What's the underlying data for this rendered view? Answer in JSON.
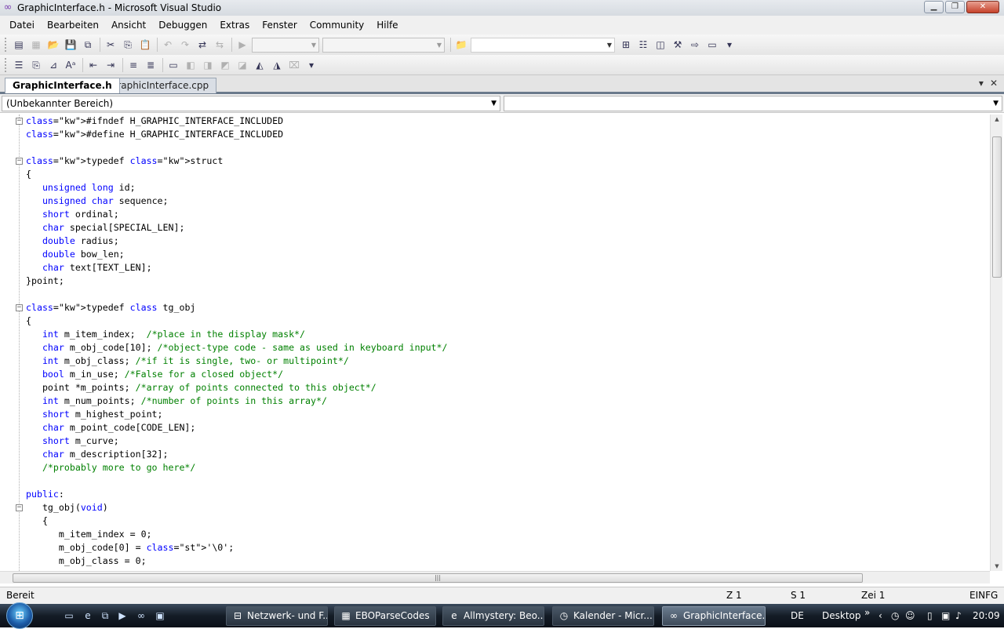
{
  "window": {
    "title": "GraphicInterface.h - Microsoft Visual Studio"
  },
  "menubar": {
    "items": [
      "Datei",
      "Bearbeiten",
      "Ansicht",
      "Debuggen",
      "Extras",
      "Fenster",
      "Community",
      "Hilfe"
    ]
  },
  "tabs": {
    "active": "GraphicInterface.h",
    "inactive": "GraphicInterface.cpp"
  },
  "navbar": {
    "scope": "(Unbekannter Bereich)",
    "member": ""
  },
  "code": {
    "lines": [
      [
        "#ifndef H_GRAPHIC_INTERFACE_INCLUDED"
      ],
      [
        "#define H_GRAPHIC_INTERFACE_INCLUDED"
      ],
      [
        ""
      ],
      [
        "typedef struct"
      ],
      [
        "{"
      ],
      [
        "   unsigned long id;"
      ],
      [
        "   unsigned char sequence;"
      ],
      [
        "   short ordinal;"
      ],
      [
        "   char special[SPECIAL_LEN];"
      ],
      [
        "   double radius;"
      ],
      [
        "   double bow_len;"
      ],
      [
        "   char text[TEXT_LEN];"
      ],
      [
        "}point;"
      ],
      [
        ""
      ],
      [
        "typedef class tg_obj"
      ],
      [
        "{"
      ],
      [
        "   int m_item_index;  /*place in the display mask*/"
      ],
      [
        "   char m_obj_code[10]; /*object-type code - same as used in keyboard input*/"
      ],
      [
        "   int m_obj_class; /*if it is single, two- or multipoint*/"
      ],
      [
        "   bool m_in_use; /*False for a closed object*/"
      ],
      [
        "   point *m_points; /*array of points connected to this object*/"
      ],
      [
        "   int m_num_points; /*number of points in this array*/"
      ],
      [
        "   short m_highest_point;"
      ],
      [
        "   char m_point_code[CODE_LEN];"
      ],
      [
        "   short m_curve;"
      ],
      [
        "   char m_description[32];"
      ],
      [
        "   /*probably more to go here*/"
      ],
      [
        ""
      ],
      [
        "public:"
      ],
      [
        "   tg_obj(void)"
      ],
      [
        "   {"
      ],
      [
        "      m_item_index = 0;"
      ],
      [
        "      m_obj_code[0] = '\\0';"
      ],
      [
        "      m_obj_class = 0;"
      ]
    ],
    "keywords": [
      "#ifndef",
      "#define",
      "typedef",
      "struct",
      "class",
      "unsigned",
      "long",
      "char",
      "short",
      "double",
      "int",
      "bool",
      "public",
      "void"
    ]
  },
  "status": {
    "ready": "Bereit",
    "line": "Z 1",
    "col": "S 1",
    "char": "Zei 1",
    "mode": "EINFG"
  },
  "taskbar": {
    "tasks": [
      "Netzwerk- und F...",
      "EBOParseCodes",
      "Allmystery: Beo...",
      "Kalender - Micr...",
      "GraphicInterface..."
    ],
    "lang": "DE",
    "desktop": "Desktop",
    "chevron": "»",
    "clock": "20:09"
  },
  "colors": {
    "keyword": "#0000ff",
    "comment": "#008000",
    "string": "#a31515",
    "tab_border": "#6b7a8c"
  }
}
